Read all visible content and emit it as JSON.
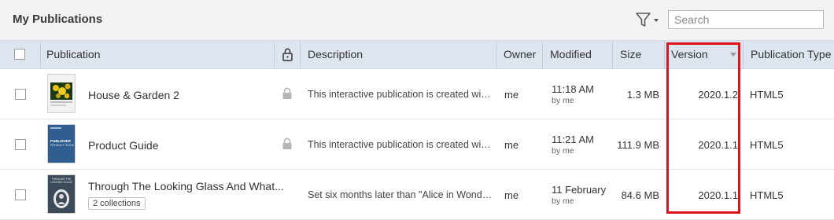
{
  "header": {
    "title": "My Publications",
    "search_placeholder": "Search"
  },
  "columns": {
    "publication": "Publication",
    "description": "Description",
    "owner": "Owner",
    "modified": "Modified",
    "size": "Size",
    "version": "Version",
    "publication_type": "Publication Type"
  },
  "rows": [
    {
      "title": "House & Garden 2",
      "description": "This interactive publication is created with...",
      "owner": "me",
      "modified_time": "11:18 AM",
      "modified_by": "by me",
      "size": "1.3 MB",
      "version": "2020.1.2",
      "type": "HTML5",
      "locked": true
    },
    {
      "title": "Product Guide",
      "description": "This interactive publication is created with...",
      "owner": "me",
      "modified_time": "11:21 AM",
      "modified_by": "by me",
      "size": "111.9 MB",
      "version": "2020.1.1",
      "type": "HTML5",
      "locked": true
    },
    {
      "title": "Through The Looking Glass And What...",
      "collections": "2 collections",
      "description": "Set six months later than \"Alice in Wonderl...",
      "owner": "me",
      "modified_time": "11 February",
      "modified_by": "by me",
      "size": "84.6 MB",
      "version": "2020.1.1",
      "type": "HTML5",
      "locked": false
    }
  ],
  "thumbnails": {
    "product_guide": {
      "line1": "PUBLISHER",
      "line2": "PRODUCT GUIDE"
    },
    "looking_glass": {
      "line1": "THROUGH THE",
      "line2": "LOOKING GLASS"
    }
  },
  "colors": {
    "header_bg": "#dde5ef",
    "topbar_bg": "#f3f3f3",
    "highlight": "#e2121b",
    "product_guide_cover": "#2f5d8f",
    "looking_glass_cover": "#3b4b5a"
  }
}
